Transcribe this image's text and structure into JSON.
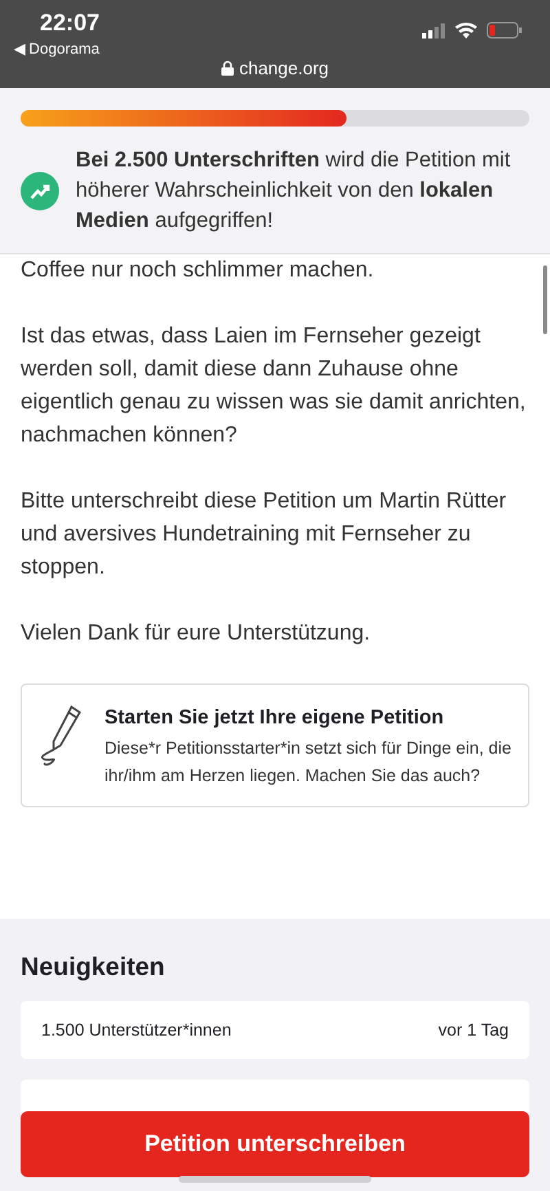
{
  "status_bar": {
    "time": "22:07",
    "back_app": "◀ Dogorama",
    "url": "change.org"
  },
  "progress_banner": {
    "level": 0.64,
    "message": "**Bei 2.500 Unterschriften** wird die Petition mit höherer Wahrscheinlichkeit von den **lokalen Medien** aufgegriffen!"
  },
  "paragraphs": [
    "Coffee nur noch schlimmer machen.",
    "Ist das etwas, dass Laien im Fernseher gezeigt werden soll, damit diese dann Zuhause ohne eigentlich genau zu wissen was sie damit anrichten, nachmachen können?",
    "Bitte unterschreibt diese Petition um Martin Rütter und aversives Hundetraining mit Fernseher zu stoppen.",
    "Vielen Dank für eure Unterstützung."
  ],
  "start_card": {
    "title": "Starten Sie jetzt Ihre eigene Petition",
    "text": "Diese*r Petitionsstarter*in setzt sich für Dinge ein, die ihr/ihm am Herzen liegen. Machen Sie das auch?"
  },
  "updates": {
    "heading": "Neuigkeiten",
    "items": [
      {
        "text": "1.500 Unterstützer*innen",
        "time": "vor 1 Tag"
      }
    ]
  },
  "sign_button": "Petition unterschreiben"
}
